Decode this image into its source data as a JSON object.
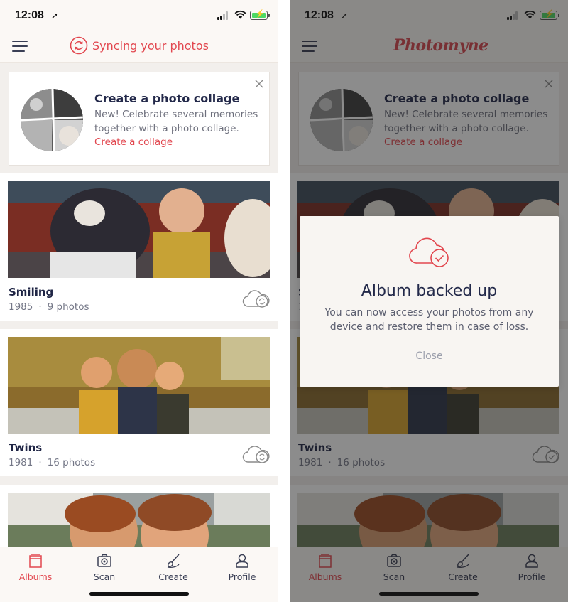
{
  "status_bar": {
    "time": "12:08",
    "location_arrow": "➚"
  },
  "left_screen": {
    "header": {
      "sync_icon": "sync-icon",
      "title": "Syncing your photos"
    }
  },
  "right_screen": {
    "header": {
      "brand": "Photomyne"
    },
    "dialog": {
      "icon": "cloud-check-icon",
      "title": "Album backed up",
      "message": "You can now access your photos from any device and restore them in case of loss.",
      "close_label": "Close"
    }
  },
  "promo": {
    "title": "Create a photo collage",
    "text": "New! Celebrate several memories together with a photo collage.",
    "link": "Create a collage"
  },
  "albums": [
    {
      "title": "Smiling",
      "year": "1985",
      "separator": "·",
      "count": "9 photos",
      "status_icon": "cloud-sync-icon"
    },
    {
      "title": "Twins",
      "year": "1981",
      "separator": "·",
      "count": "16 photos",
      "status_icon": "cloud-sync-icon"
    }
  ],
  "tabs": [
    {
      "label": "Albums",
      "icon": "albums-icon"
    },
    {
      "label": "Scan",
      "icon": "camera-icon"
    },
    {
      "label": "Create",
      "icon": "brush-icon"
    },
    {
      "label": "Profile",
      "icon": "person-icon"
    }
  ],
  "colors": {
    "accent": "#e2474f",
    "text_dark": "#23294a",
    "background": "#f2efec"
  }
}
